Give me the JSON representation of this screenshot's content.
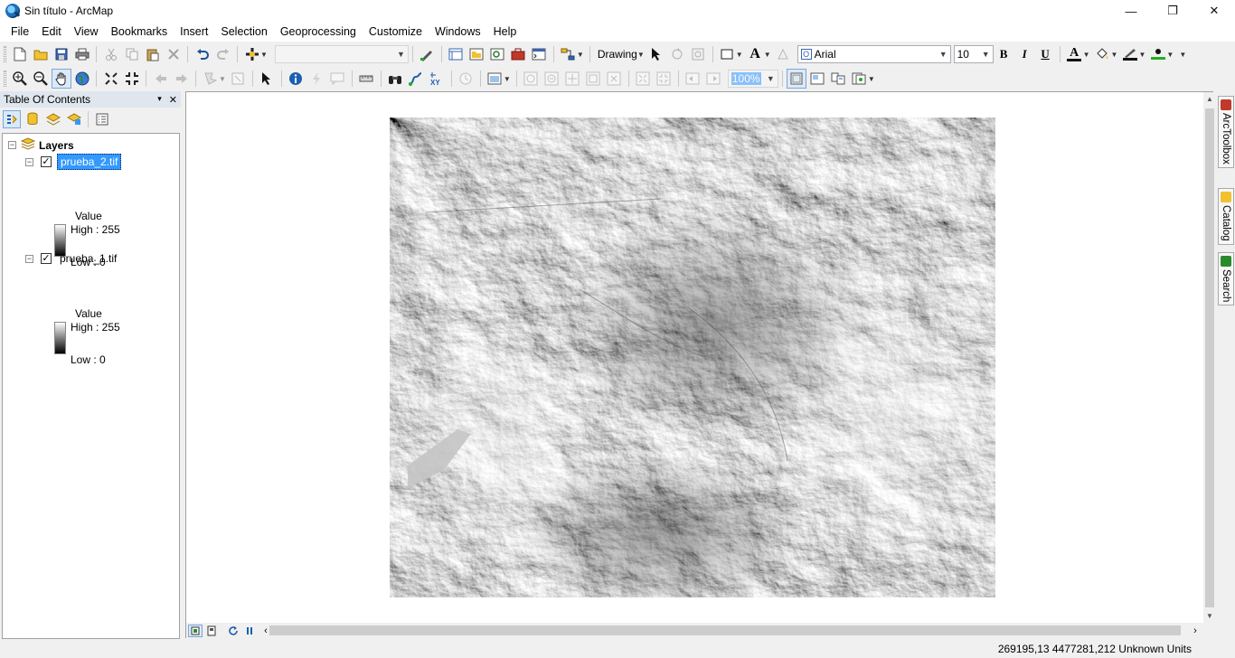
{
  "window": {
    "title": "Sin título - ArcMap",
    "controls": {
      "minimize": "—",
      "maximize": "❐",
      "close": "✕"
    }
  },
  "menu": [
    "File",
    "Edit",
    "View",
    "Bookmarks",
    "Insert",
    "Selection",
    "Geoprocessing",
    "Customize",
    "Windows",
    "Help"
  ],
  "toolbar": {
    "drawing_label": "Drawing",
    "font_name": "Arial",
    "font_size": "10",
    "bold": "B",
    "italic": "I",
    "underline": "U",
    "font_color_glyph": "A",
    "text_tool_glyph": "A",
    "zoom_percent": "100%"
  },
  "toc": {
    "title": "Table Of Contents",
    "pin_glyph": "📌",
    "close_glyph": "✕",
    "root": "Layers",
    "layers": [
      {
        "name": "prueba_2.tif",
        "checked": true,
        "selected": true,
        "field": "Value",
        "high": "High : 255",
        "low": "Low : 0"
      },
      {
        "name": "prueba_1.tif",
        "checked": true,
        "selected": false,
        "field": "Value",
        "high": "High : 255",
        "low": "Low : 0"
      }
    ]
  },
  "dock": {
    "tabs": [
      "ArcToolbox",
      "Catalog",
      "Search"
    ]
  },
  "status": {
    "coordinates": "269195,13  4477281,212 Unknown Units"
  },
  "colors": {
    "selection": "#3399ff",
    "accent_yellow": "#f2c12e",
    "font_color_bar": "#cc0000",
    "line_color_bar": "#20b020"
  }
}
